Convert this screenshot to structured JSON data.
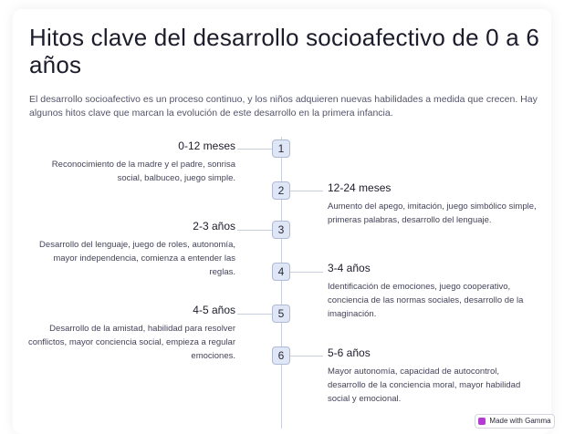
{
  "title": "Hitos clave del desarrollo socioafectivo de 0 a 6 años",
  "intro": "El desarrollo socioafectivo es un proceso continuo, y los niños adquieren nuevas habilidades a medida que crecen. Hay algunos hitos clave que marcan la evolución de este desarrollo en la primera infancia.",
  "timeline": [
    {
      "number": "1",
      "period": "0-12 meses",
      "description": "Reconocimiento de la madre y el padre, sonrisa social, balbuceo, juego simple."
    },
    {
      "number": "2",
      "period": "12-24 meses",
      "description": "Aumento del apego, imitación, juego simbólico simple, primeras palabras, desarrollo del lenguaje."
    },
    {
      "number": "3",
      "period": "2-3 años",
      "description": "Desarrollo del lenguaje, juego de roles, autonomía, mayor independencia, comienza a entender las reglas."
    },
    {
      "number": "4",
      "period": "3-4 años",
      "description": "Identificación de emociones, juego cooperativo, conciencia de las normas sociales, desarrollo de la imaginación."
    },
    {
      "number": "5",
      "period": "4-5 años",
      "description": "Desarrollo de la amistad, habilidad para resolver conflictos, mayor conciencia social, empieza a regular emociones."
    },
    {
      "number": "6",
      "period": "5-6 años",
      "description": "Mayor autonomía, capacidad de autocontrol, desarrollo de la conciencia moral, mayor habilidad social y emocional."
    }
  ],
  "badge": {
    "label": "Made with Gamma",
    "icon": "gamma-logo-icon",
    "color": "#b43bd1"
  }
}
